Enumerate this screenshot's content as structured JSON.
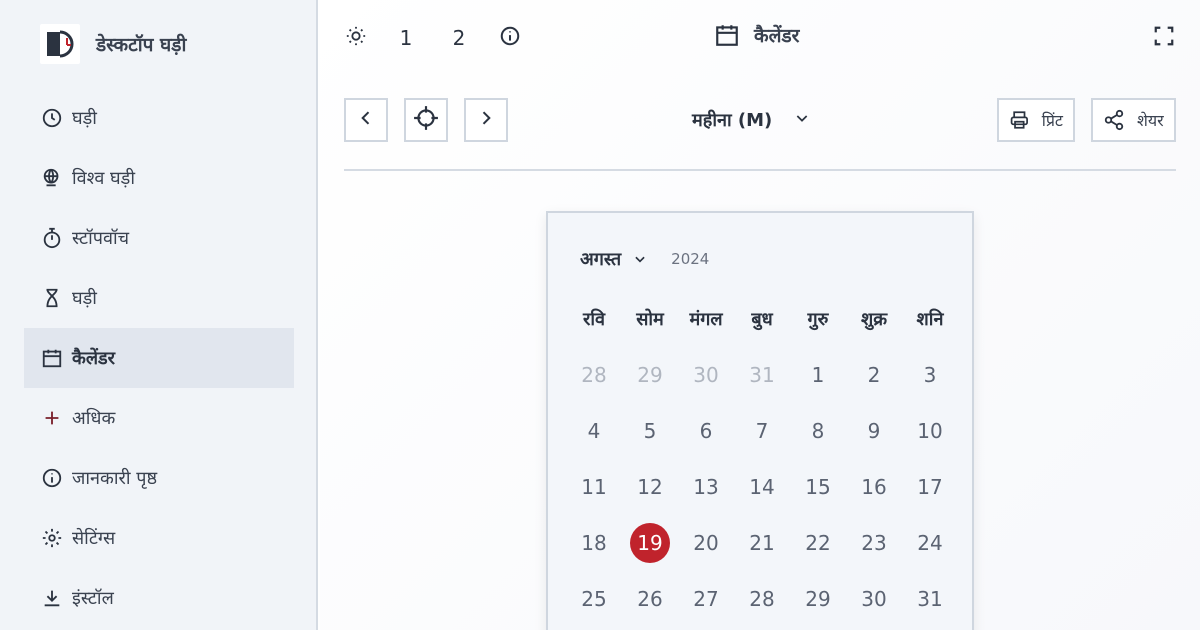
{
  "app": {
    "title": "डेस्कटॉप घड़ी"
  },
  "sidebar": {
    "items": [
      {
        "label": "घड़ी",
        "icon": "clock-icon",
        "active": false
      },
      {
        "label": "विश्व घड़ी",
        "icon": "globe-clock-icon",
        "active": false
      },
      {
        "label": "स्टॉपवॉच",
        "icon": "stopwatch-icon",
        "active": false
      },
      {
        "label": "घड़ी",
        "icon": "hourglass-icon",
        "active": false
      },
      {
        "label": "कैलेंडर",
        "icon": "calendar-icon",
        "active": true
      },
      {
        "label": "अधिक",
        "icon": "plus-icon",
        "active": false
      },
      {
        "label": "जानकारी पृष्ठ",
        "icon": "info-icon",
        "active": false
      },
      {
        "label": "सेटिंग्स",
        "icon": "gear-icon",
        "active": false
      },
      {
        "label": "इंस्टॉल",
        "icon": "download-icon",
        "active": false
      }
    ]
  },
  "topbar": {
    "theme_icon": "sun-icon",
    "option_1": "1",
    "option_2": "2",
    "info_icon": "info-icon",
    "title": "कैलेंडर",
    "fullscreen_icon": "fullscreen-icon"
  },
  "toolbar": {
    "view_label": "महीना (M)",
    "print_label": "प्रिंट",
    "share_label": "शेयर"
  },
  "calendar": {
    "month": "अगस्त",
    "year": "2024",
    "weekdays": [
      "रवि",
      "सोम",
      "मंगल",
      "बुध",
      "गुरु",
      "शुक्र",
      "शनि"
    ],
    "days": [
      {
        "n": "28",
        "muted": true
      },
      {
        "n": "29",
        "muted": true
      },
      {
        "n": "30",
        "muted": true
      },
      {
        "n": "31",
        "muted": true
      },
      {
        "n": "1"
      },
      {
        "n": "2"
      },
      {
        "n": "3"
      },
      {
        "n": "4"
      },
      {
        "n": "5"
      },
      {
        "n": "6"
      },
      {
        "n": "7"
      },
      {
        "n": "8"
      },
      {
        "n": "9"
      },
      {
        "n": "10"
      },
      {
        "n": "11"
      },
      {
        "n": "12"
      },
      {
        "n": "13"
      },
      {
        "n": "14"
      },
      {
        "n": "15"
      },
      {
        "n": "16"
      },
      {
        "n": "17"
      },
      {
        "n": "18"
      },
      {
        "n": "19",
        "today": true
      },
      {
        "n": "20"
      },
      {
        "n": "21"
      },
      {
        "n": "22"
      },
      {
        "n": "23"
      },
      {
        "n": "24"
      },
      {
        "n": "25"
      },
      {
        "n": "26"
      },
      {
        "n": "27"
      },
      {
        "n": "28"
      },
      {
        "n": "29"
      },
      {
        "n": "30"
      },
      {
        "n": "31"
      }
    ]
  },
  "colors": {
    "accent": "#c0232c",
    "sidebar_bg": "#f1f4f8",
    "active_bg": "#e1e6ee"
  }
}
